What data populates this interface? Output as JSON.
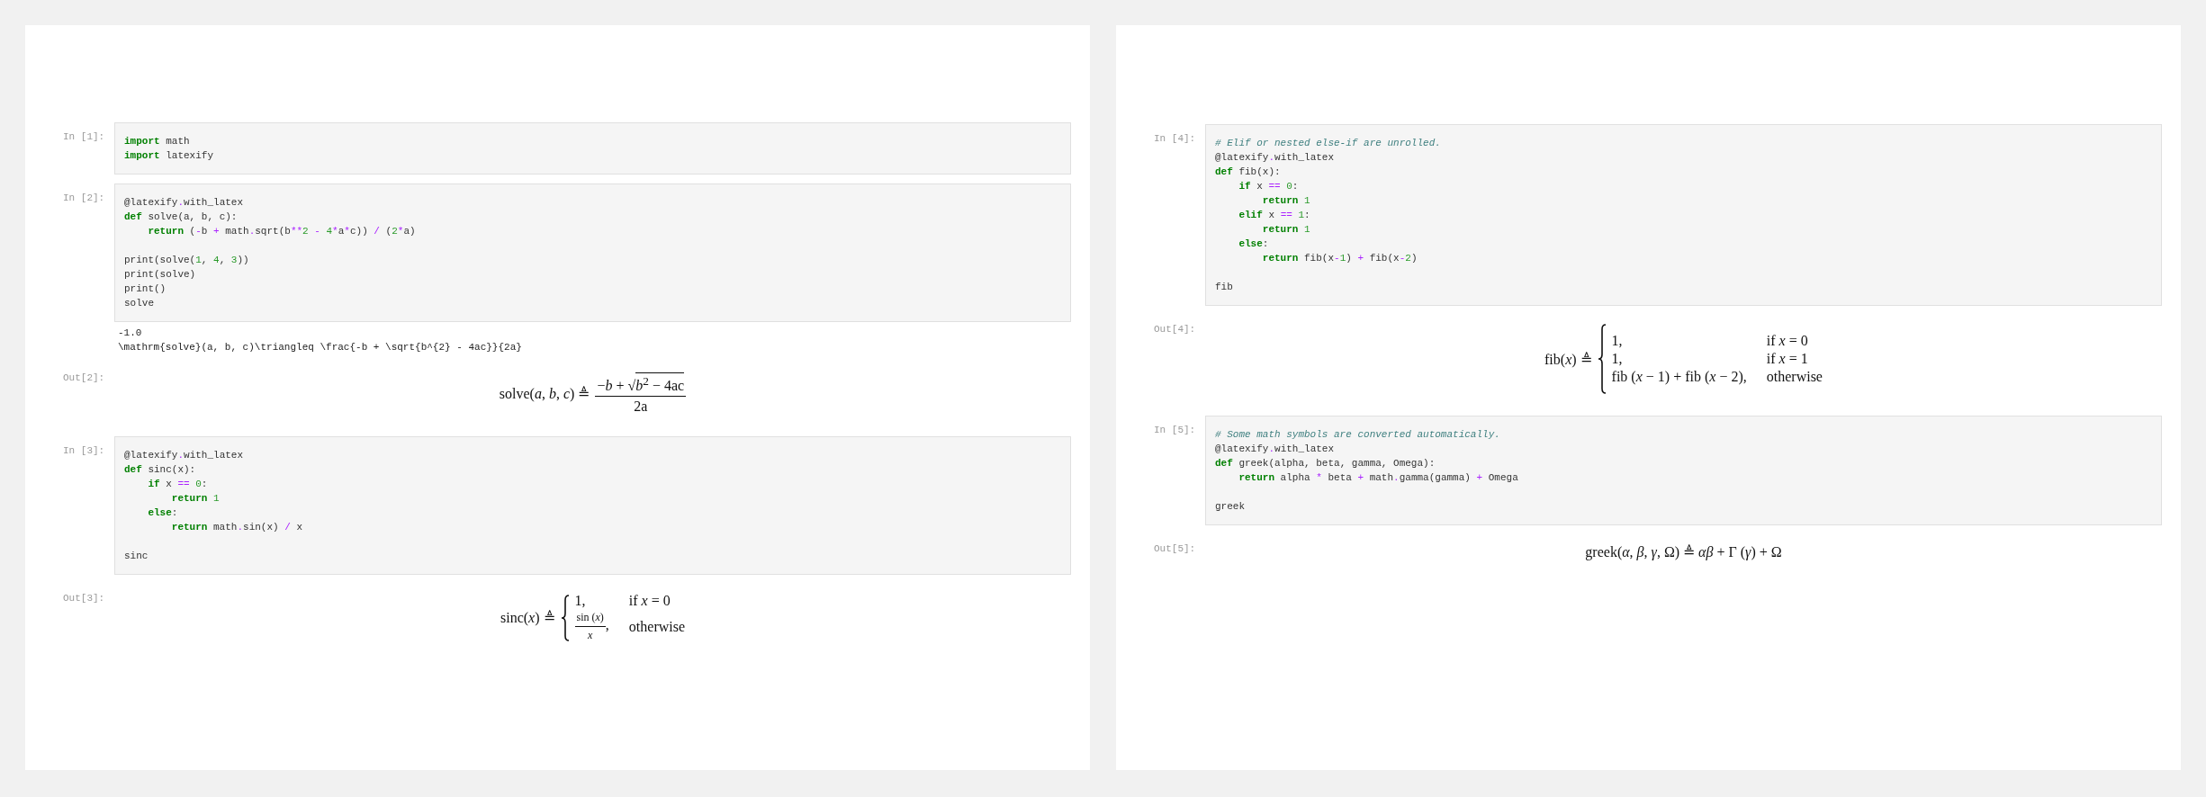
{
  "pages": [
    {
      "cells": [
        {
          "kind": "input",
          "prompt": "In [1]:",
          "blocks": [
            [
              [
                {
                  "kind": "keyword",
                  "text": "import"
                },
                {
                  "kind": "plain",
                  "text": " math"
                }
              ],
              [
                {
                  "kind": "keyword",
                  "text": "import"
                },
                {
                  "kind": "plain",
                  "text": " latexify"
                }
              ]
            ]
          ]
        },
        {
          "kind": "input",
          "prompt": "In [2]:",
          "blocks": [
            [
              [
                {
                  "kind": "plain",
                  "text": "@latexify"
                },
                {
                  "kind": "operator",
                  "text": "."
                },
                {
                  "kind": "plain",
                  "text": "with_latex"
                }
              ],
              [
                {
                  "kind": "keyword",
                  "text": "def"
                },
                {
                  "kind": "plain",
                  "text": " solve(a, b, c):"
                }
              ],
              [
                {
                  "kind": "keyword",
                  "text": "    return"
                },
                {
                  "kind": "plain",
                  "text": " ("
                },
                {
                  "kind": "operator",
                  "text": "-"
                },
                {
                  "kind": "plain",
                  "text": "b "
                },
                {
                  "kind": "operator",
                  "text": "+"
                },
                {
                  "kind": "plain",
                  "text": " math"
                },
                {
                  "kind": "operator",
                  "text": "."
                },
                {
                  "kind": "plain",
                  "text": "sqrt(b"
                },
                {
                  "kind": "operator",
                  "text": "**"
                },
                {
                  "kind": "number",
                  "text": "2"
                },
                {
                  "kind": "operator",
                  "text": " - "
                },
                {
                  "kind": "number",
                  "text": "4"
                },
                {
                  "kind": "operator",
                  "text": "*"
                },
                {
                  "kind": "plain",
                  "text": "a"
                },
                {
                  "kind": "operator",
                  "text": "*"
                },
                {
                  "kind": "plain",
                  "text": "c)) "
                },
                {
                  "kind": "operator",
                  "text": "/"
                },
                {
                  "kind": "plain",
                  "text": " ("
                },
                {
                  "kind": "number",
                  "text": "2"
                },
                {
                  "kind": "operator",
                  "text": "*"
                },
                {
                  "kind": "plain",
                  "text": "a)"
                }
              ]
            ],
            [
              [
                {
                  "kind": "plain",
                  "text": "print(solve("
                },
                {
                  "kind": "number",
                  "text": "1"
                },
                {
                  "kind": "plain",
                  "text": ", "
                },
                {
                  "kind": "number",
                  "text": "4"
                },
                {
                  "kind": "plain",
                  "text": ", "
                },
                {
                  "kind": "number",
                  "text": "3"
                },
                {
                  "kind": "plain",
                  "text": "))"
                }
              ],
              [
                {
                  "kind": "plain",
                  "text": "print(solve)"
                }
              ],
              [
                {
                  "kind": "plain",
                  "text": "print()"
                }
              ],
              [
                {
                  "kind": "plain",
                  "text": "solve"
                }
              ]
            ]
          ]
        },
        {
          "kind": "stream",
          "lines": [
            "-1.0",
            "\\mathrm{solve}(a, b, c)\\triangleq \\frac{-b + \\sqrt{b^{2} - 4ac}}{2a}"
          ]
        },
        {
          "kind": "math",
          "prompt": "Out[2]:",
          "math": {
            "kind": "fraction",
            "lhs": "solve(*a*, *b*, *c*)",
            "op": "≜",
            "numerator_pre": "−*b* + ",
            "radical": "√",
            "radicand": "*b*$^{2}$ − 4ac",
            "denominator": "2a"
          }
        },
        {
          "kind": "input",
          "prompt": "In [3]:",
          "blocks": [
            [
              [
                {
                  "kind": "plain",
                  "text": "@latexify"
                },
                {
                  "kind": "operator",
                  "text": "."
                },
                {
                  "kind": "plain",
                  "text": "with_latex"
                }
              ],
              [
                {
                  "kind": "keyword",
                  "text": "def"
                },
                {
                  "kind": "plain",
                  "text": " sinc(x):"
                }
              ],
              [
                {
                  "kind": "keyword",
                  "text": "    if"
                },
                {
                  "kind": "plain",
                  "text": " x "
                },
                {
                  "kind": "operator",
                  "text": "=="
                },
                {
                  "kind": "number",
                  "text": " 0"
                },
                {
                  "kind": "plain",
                  "text": ":"
                }
              ],
              [
                {
                  "kind": "keyword",
                  "text": "        return"
                },
                {
                  "kind": "number",
                  "text": " 1"
                }
              ],
              [
                {
                  "kind": "keyword",
                  "text": "    else"
                },
                {
                  "kind": "plain",
                  "text": ":"
                }
              ],
              [
                {
                  "kind": "keyword",
                  "text": "        return"
                },
                {
                  "kind": "plain",
                  "text": " math"
                },
                {
                  "kind": "operator",
                  "text": "."
                },
                {
                  "kind": "plain",
                  "text": "sin(x) "
                },
                {
                  "kind": "operator",
                  "text": "/"
                },
                {
                  "kind": "plain",
                  "text": " x"
                }
              ]
            ],
            [
              [
                {
                  "kind": "plain",
                  "text": "sinc"
                }
              ]
            ]
          ]
        },
        {
          "kind": "math",
          "prompt": "Out[3]:",
          "math": {
            "kind": "cases",
            "lhs": "sinc(*x*)",
            "op": "≜",
            "rows": [
              {
                "kind": "plain",
                "value": "1,",
                "condition": "if *x* = 0"
              },
              {
                "kind": "fraction",
                "numerator": "sin (*x*)",
                "denominator": "*x*",
                "value": ",",
                "condition": "otherwise"
              }
            ]
          }
        }
      ]
    },
    {
      "cells": [
        {
          "kind": "input",
          "prompt": "In [4]:",
          "blocks": [
            [
              [
                {
                  "kind": "comment",
                  "text": "# Elif or nested else-if are unrolled."
                }
              ],
              [
                {
                  "kind": "plain",
                  "text": "@latexify"
                },
                {
                  "kind": "operator",
                  "text": "."
                },
                {
                  "kind": "plain",
                  "text": "with_latex"
                }
              ],
              [
                {
                  "kind": "keyword",
                  "text": "def"
                },
                {
                  "kind": "plain",
                  "text": " fib(x):"
                }
              ],
              [
                {
                  "kind": "keyword",
                  "text": "    if"
                },
                {
                  "kind": "plain",
                  "text": " x "
                },
                {
                  "kind": "operator",
                  "text": "=="
                },
                {
                  "kind": "number",
                  "text": " 0"
                },
                {
                  "kind": "plain",
                  "text": ":"
                }
              ],
              [
                {
                  "kind": "keyword",
                  "text": "        return"
                },
                {
                  "kind": "number",
                  "text": " 1"
                }
              ],
              [
                {
                  "kind": "keyword",
                  "text": "    elif"
                },
                {
                  "kind": "plain",
                  "text": " x "
                },
                {
                  "kind": "operator",
                  "text": "=="
                },
                {
                  "kind": "number",
                  "text": " 1"
                },
                {
                  "kind": "plain",
                  "text": ":"
                }
              ],
              [
                {
                  "kind": "keyword",
                  "text": "        return"
                },
                {
                  "kind": "number",
                  "text": " 1"
                }
              ],
              [
                {
                  "kind": "keyword",
                  "text": "    else"
                },
                {
                  "kind": "plain",
                  "text": ":"
                }
              ],
              [
                {
                  "kind": "keyword",
                  "text": "        return"
                },
                {
                  "kind": "plain",
                  "text": " fib(x"
                },
                {
                  "kind": "operator",
                  "text": "-"
                },
                {
                  "kind": "number",
                  "text": "1"
                },
                {
                  "kind": "plain",
                  "text": ") "
                },
                {
                  "kind": "operator",
                  "text": "+"
                },
                {
                  "kind": "plain",
                  "text": " fib(x"
                },
                {
                  "kind": "operator",
                  "text": "-"
                },
                {
                  "kind": "number",
                  "text": "2"
                },
                {
                  "kind": "plain",
                  "text": ")"
                }
              ]
            ],
            [
              [
                {
                  "kind": "plain",
                  "text": "fib"
                }
              ]
            ]
          ]
        },
        {
          "kind": "math",
          "prompt": "Out[4]:",
          "math": {
            "kind": "cases",
            "lhs": "fib(*x*)",
            "op": "≜",
            "rows": [
              {
                "kind": "plain",
                "value": "1,",
                "condition": "if *x* = 0"
              },
              {
                "kind": "plain",
                "value": "1,",
                "condition": "if *x* = 1"
              },
              {
                "kind": "plain",
                "value": "fib (*x* − 1) + fib (*x* − 2),",
                "condition": "otherwise"
              }
            ]
          }
        },
        {
          "kind": "input",
          "prompt": "In [5]:",
          "blocks": [
            [
              [
                {
                  "kind": "comment",
                  "text": "# Some math symbols are converted automatically."
                }
              ],
              [
                {
                  "kind": "plain",
                  "text": "@latexify"
                },
                {
                  "kind": "operator",
                  "text": "."
                },
                {
                  "kind": "plain",
                  "text": "with_latex"
                }
              ],
              [
                {
                  "kind": "keyword",
                  "text": "def"
                },
                {
                  "kind": "plain",
                  "text": " greek(alpha, beta, gamma, Omega):"
                }
              ],
              [
                {
                  "kind": "keyword",
                  "text": "    return"
                },
                {
                  "kind": "plain",
                  "text": " alpha "
                },
                {
                  "kind": "operator",
                  "text": "*"
                },
                {
                  "kind": "plain",
                  "text": " beta "
                },
                {
                  "kind": "operator",
                  "text": "+"
                },
                {
                  "kind": "plain",
                  "text": " math"
                },
                {
                  "kind": "operator",
                  "text": "."
                },
                {
                  "kind": "plain",
                  "text": "gamma(gamma) "
                },
                {
                  "kind": "operator",
                  "text": "+"
                },
                {
                  "kind": "plain",
                  "text": " Omega"
                }
              ]
            ],
            [
              [
                {
                  "kind": "plain",
                  "text": "greek"
                }
              ]
            ]
          ]
        },
        {
          "kind": "math",
          "prompt": "Out[5]:",
          "math": {
            "kind": "inline",
            "formula": "greek(*α*, *β*, *γ*, Ω) ≜ *αβ* + Γ (*γ*) + Ω"
          }
        }
      ]
    }
  ]
}
